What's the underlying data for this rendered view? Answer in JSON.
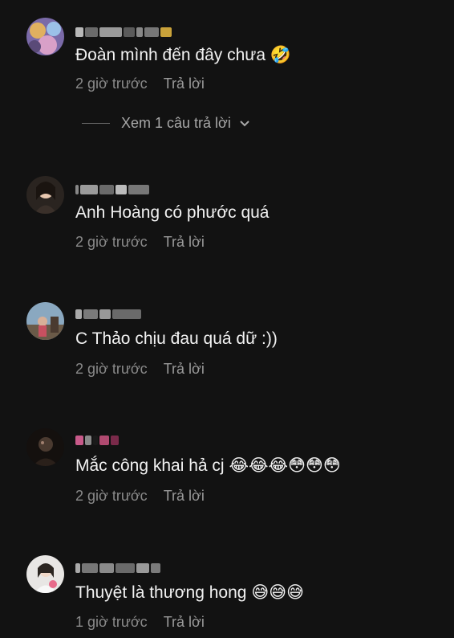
{
  "comments": [
    {
      "text": "Đoàn mình đến đây chưa",
      "emoji": "🤣",
      "time": "2 giờ trước",
      "reply": "Trả lời"
    },
    {
      "text": "Anh Hoàng có phước quá",
      "emoji": "",
      "time": "2 giờ trước",
      "reply": "Trả lời"
    },
    {
      "text": "C Thảo chịu đau quá dữ :))",
      "emoji": "",
      "time": "2 giờ trước",
      "reply": "Trả lời"
    },
    {
      "text": "Mắc công khai hả cj",
      "emoji": "😂😂😂😳😳😳",
      "time": "2 giờ trước",
      "reply": "Trả lời"
    },
    {
      "text": "Thuyệt là thương hong",
      "emoji": "😅😅😅",
      "time": "1 giờ trước",
      "reply": "Trả lời"
    }
  ],
  "view_replies": {
    "label": "Xem 1 câu trả lời",
    "icon": "chevron-down-icon"
  }
}
